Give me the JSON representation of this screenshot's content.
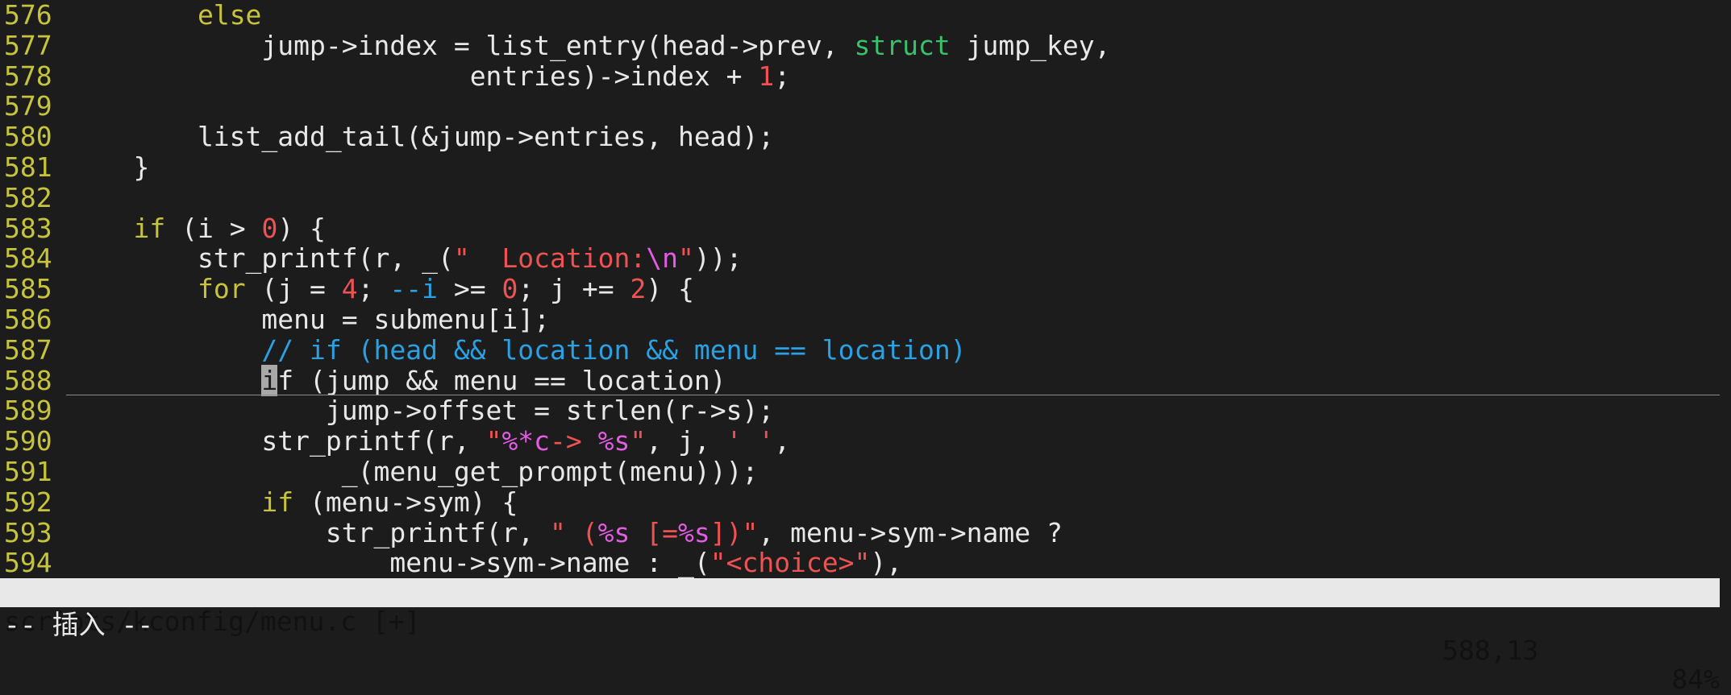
{
  "editor": {
    "lines": [
      {
        "num": "576",
        "tokens": [
          {
            "t": "        "
          },
          {
            "t": "else",
            "c": "kw"
          }
        ]
      },
      {
        "num": "577",
        "tokens": [
          {
            "t": "            jump->index = list_entry(head->prev, "
          },
          {
            "t": "struct",
            "c": "ty"
          },
          {
            "t": " jump_key,"
          }
        ]
      },
      {
        "num": "578",
        "tokens": [
          {
            "t": "                         entries)->index + "
          },
          {
            "t": "1",
            "c": "num"
          },
          {
            "t": ";"
          }
        ]
      },
      {
        "num": "579",
        "tokens": []
      },
      {
        "num": "580",
        "tokens": [
          {
            "t": "        list_add_tail(&jump->entries, head);"
          }
        ]
      },
      {
        "num": "581",
        "tokens": [
          {
            "t": "    }"
          }
        ]
      },
      {
        "num": "582",
        "tokens": []
      },
      {
        "num": "583",
        "tokens": [
          {
            "t": "    "
          },
          {
            "t": "if",
            "c": "kw"
          },
          {
            "t": " (i > "
          },
          {
            "t": "0",
            "c": "num"
          },
          {
            "t": ") {"
          }
        ]
      },
      {
        "num": "584",
        "tokens": [
          {
            "t": "        str_printf(r, _("
          },
          {
            "t": "\"  Location:",
            "c": "str"
          },
          {
            "t": "\\n",
            "c": "esc"
          },
          {
            "t": "\"",
            "c": "str"
          },
          {
            "t": "));"
          }
        ]
      },
      {
        "num": "585",
        "tokens": [
          {
            "t": "        "
          },
          {
            "t": "for",
            "c": "kw"
          },
          {
            "t": " (j = "
          },
          {
            "t": "4",
            "c": "num"
          },
          {
            "t": "; "
          },
          {
            "t": "--i",
            "c": "cm"
          },
          {
            "t": " >= "
          },
          {
            "t": "0",
            "c": "num"
          },
          {
            "t": "; j += "
          },
          {
            "t": "2",
            "c": "num"
          },
          {
            "t": ") {"
          }
        ]
      },
      {
        "num": "586",
        "tokens": [
          {
            "t": "            menu = submenu[i];"
          }
        ]
      },
      {
        "num": "587",
        "tokens": [
          {
            "t": "            "
          },
          {
            "t": "// if (head && location && menu == location)",
            "c": "cm"
          }
        ]
      },
      {
        "num": "588",
        "current": true,
        "tokens": [
          {
            "t": "            "
          },
          {
            "t": "i",
            "c": "cur"
          },
          {
            "t": "f (jump && menu == location)"
          }
        ]
      },
      {
        "num": "589",
        "tokens": [
          {
            "t": "                jump->offset = strlen(r->s);"
          }
        ]
      },
      {
        "num": "590",
        "tokens": [
          {
            "t": "            str_printf(r, "
          },
          {
            "t": "\"",
            "c": "str"
          },
          {
            "t": "%*c",
            "c": "esc"
          },
          {
            "t": "-> ",
            "c": "str"
          },
          {
            "t": "%s",
            "c": "esc"
          },
          {
            "t": "\"",
            "c": "str"
          },
          {
            "t": ", j, "
          },
          {
            "t": "' '",
            "c": "str"
          },
          {
            "t": ","
          }
        ]
      },
      {
        "num": "591",
        "tokens": [
          {
            "t": "                 _(menu_get_prompt(menu)));"
          }
        ]
      },
      {
        "num": "592",
        "tokens": [
          {
            "t": "            "
          },
          {
            "t": "if",
            "c": "kw"
          },
          {
            "t": " (menu->sym) {"
          }
        ]
      },
      {
        "num": "593",
        "tokens": [
          {
            "t": "                str_printf(r, "
          },
          {
            "t": "\" (",
            "c": "str"
          },
          {
            "t": "%s",
            "c": "esc"
          },
          {
            "t": " [=",
            "c": "str"
          },
          {
            "t": "%s",
            "c": "esc"
          },
          {
            "t": "])\"",
            "c": "str"
          },
          {
            "t": ", menu->sym->name ?"
          }
        ]
      },
      {
        "num": "594",
        "tokens": [
          {
            "t": "                    menu->sym->name : _("
          },
          {
            "t": "\"<choice>\"",
            "c": "str"
          },
          {
            "t": "),"
          }
        ]
      }
    ]
  },
  "status": {
    "file": "scripts/kconfig/menu.c [+]",
    "position": "588,13",
    "percent": "84%"
  },
  "mode": "-- 插入 --"
}
